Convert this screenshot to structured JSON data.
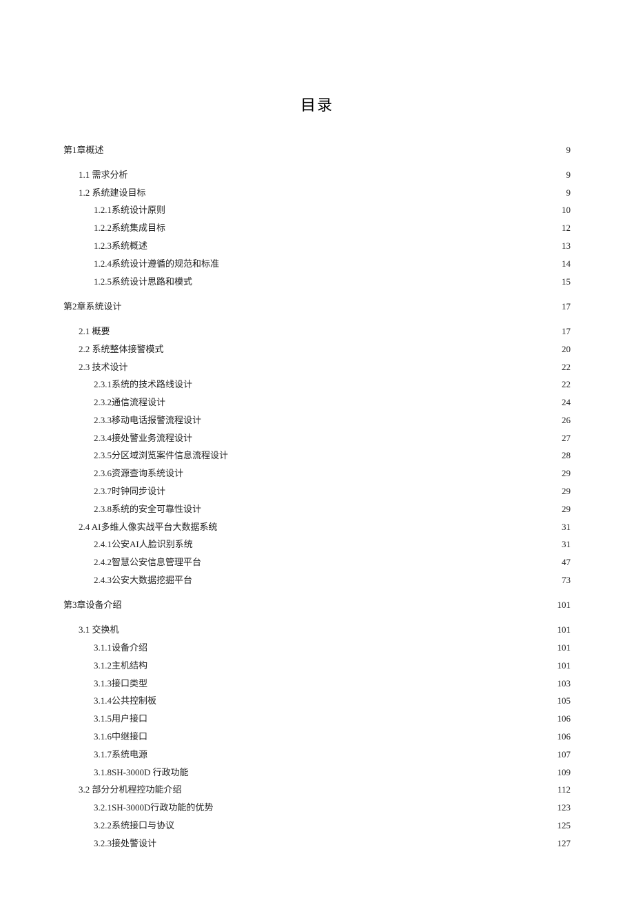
{
  "title": "目录",
  "entries": [
    {
      "label": "第1章概述",
      "page": "9",
      "level": 0,
      "gapAfter": true
    },
    {
      "label": "1.1 需求分析",
      "page": "9",
      "level": 1
    },
    {
      "label": "1.2 系统建设目标",
      "page": "9",
      "level": 1
    },
    {
      "label": "1.2.1系统设计原则 ",
      "page": " 10",
      "level": 2
    },
    {
      "label": "1.2.2系统集成目标",
      "page": "12",
      "level": 2
    },
    {
      "label": "1.2.3系统概述",
      "page": "13",
      "level": 2
    },
    {
      "label": "1.2.4系统设计遵循的规范和标准 ",
      "page": "14",
      "level": 2
    },
    {
      "label": "1.2.5系统设计思路和模式 ",
      "page": "15",
      "level": 2
    },
    {
      "label": "第2章系统设计",
      "page": "17",
      "level": 0,
      "gapBefore": true,
      "gapAfter": true
    },
    {
      "label": "2.1 概要",
      "page": "17",
      "level": 1
    },
    {
      "label": "2.2 系统整体接警模式 ",
      "page": "20",
      "level": 1
    },
    {
      "label": "2.3 技术设计",
      "page": "22",
      "level": 1
    },
    {
      "label": "2.3.1系统的技术路线设计 ",
      "page": "22",
      "level": 2
    },
    {
      "label": "2.3.2通信流程设计 ",
      "page": " 24",
      "level": 2
    },
    {
      "label": "2.3.3移动电话报警流程设计 ",
      "page": "26",
      "level": 2
    },
    {
      "label": "2.3.4接处警业务流程设计 ",
      "page": "27",
      "level": 2
    },
    {
      "label": "2.3.5分区域浏览案件信息流程设计 ",
      "page": "28",
      "level": 2
    },
    {
      "label": "2.3.6资源查询系统设计 ",
      "page": "29",
      "level": 2
    },
    {
      "label": "2.3.7时钟同步设计",
      "page": "29",
      "level": 2
    },
    {
      "label": "2.3.8系统的安全可靠性设计 ",
      "page": "29",
      "level": 2
    },
    {
      "label": "2.4 AI多维人像实战平台大数据系统 ",
      "page": "31",
      "level": 1
    },
    {
      "label": "2.4.1公安AI人脸识别系统 ",
      "page": " 31",
      "level": 2
    },
    {
      "label": "2.4.2智慧公安信息管理平台 ",
      "page": "47",
      "level": 2
    },
    {
      "label": "2.4.3公安大数据挖掘平台 ",
      "page": " 73",
      "level": 2
    },
    {
      "label": "第3章设备介绍",
      "page": "101",
      "level": 0,
      "gapBefore": true,
      "gapAfter": true
    },
    {
      "label": "3.1 交换机",
      "page": "101",
      "level": 1
    },
    {
      "label": "3.1.1设备介绍",
      "page": "101",
      "level": 2
    },
    {
      "label": "3.1.2主机结构",
      "page": "101",
      "level": 2
    },
    {
      "label": "3.1.3接口类型",
      "page": "103",
      "level": 2
    },
    {
      "label": "3.1.4公共控制板 ",
      "page": " 105",
      "level": 2
    },
    {
      "label": "3.1.5用户接口 ",
      "page": " 106",
      "level": 2
    },
    {
      "label": "3.1.6中继接口 ",
      "page": " 106",
      "level": 2
    },
    {
      "label": "3.1.7系统电源 ",
      "page": " 107",
      "level": 2
    },
    {
      "label": "3.1.8SH-3000D 行政功能 ",
      "page": "109",
      "level": 2
    },
    {
      "label": "3.2 部分分机程控功能介绍 ",
      "page": " 112",
      "level": 1
    },
    {
      "label": "3.2.1SH-3000D行政功能的优势 ",
      "page": "123",
      "level": 2
    },
    {
      "label": "3.2.2系统接口与协议 ",
      "page": "125",
      "level": 2
    },
    {
      "label": "3.2.3接处警设计",
      "page": "127",
      "level": 2
    }
  ]
}
